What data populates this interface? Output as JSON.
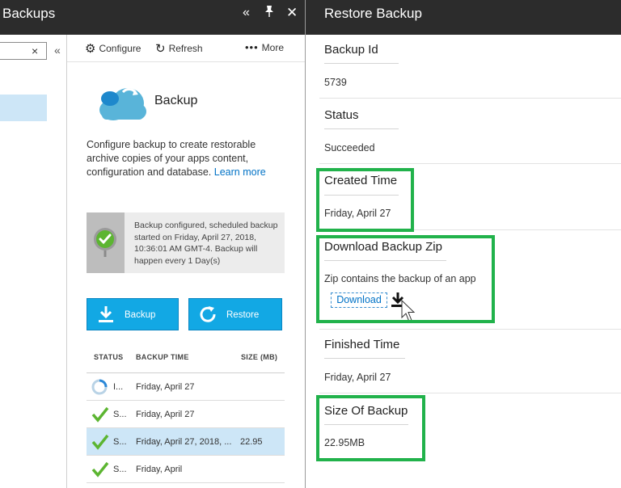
{
  "backups_blade": {
    "title": "Backups",
    "header_icons": {
      "collapse": "collapse-icon",
      "pin": "pin-icon",
      "close": "close-icon"
    },
    "filter_clear_icon": "×",
    "collapse_inner_icon": "«",
    "toolbar": {
      "configure_label": "Configure",
      "refresh_label": "Refresh",
      "more_label": "More"
    },
    "heading": "Backup",
    "description": "Configure backup to create restorable archive copies of your apps content, configuration and database.",
    "learn_more": "Learn more",
    "notice": "Backup configured, scheduled backup started on Friday, April 27, 2018, 10:36:01 AM GMT-4. Backup will happen every 1 Day(s)",
    "buttons": {
      "backup_label": "Backup",
      "restore_label": "Restore"
    },
    "table": {
      "headers": {
        "status": "STATUS",
        "backup_time": "BACKUP TIME",
        "size": "SIZE (MB)"
      },
      "rows": [
        {
          "status": "I...",
          "time": "Friday, April 27",
          "size": ""
        },
        {
          "status": "S...",
          "time": "Friday, April 27",
          "size": ""
        },
        {
          "status": "S...",
          "time": "Friday, April 27, 2018, ...",
          "size": "22.95"
        },
        {
          "status": "S...",
          "time": "Friday, April",
          "size": ""
        }
      ]
    }
  },
  "restore_blade": {
    "title": "Restore Backup",
    "backup_id_label": "Backup Id",
    "backup_id_value": "5739",
    "status_label": "Status",
    "status_value": "Succeeded",
    "created_time_label": "Created Time",
    "created_time_value": "Friday, April 27",
    "download_zip_label": "Download Backup Zip",
    "download_zip_desc": "Zip contains the backup of an app",
    "download_link": "Download",
    "finished_time_label": "Finished Time",
    "finished_time_value": "Friday, April 27",
    "size_label": "Size Of Backup",
    "size_value": "22.95MB"
  },
  "colors": {
    "header_bg": "#2c2c2c",
    "accent_blue": "#12a8e4",
    "link_blue": "#0072c6",
    "success_green": "#5cb531",
    "highlight_green": "#21b24b",
    "selected_row": "#cde6f7"
  }
}
